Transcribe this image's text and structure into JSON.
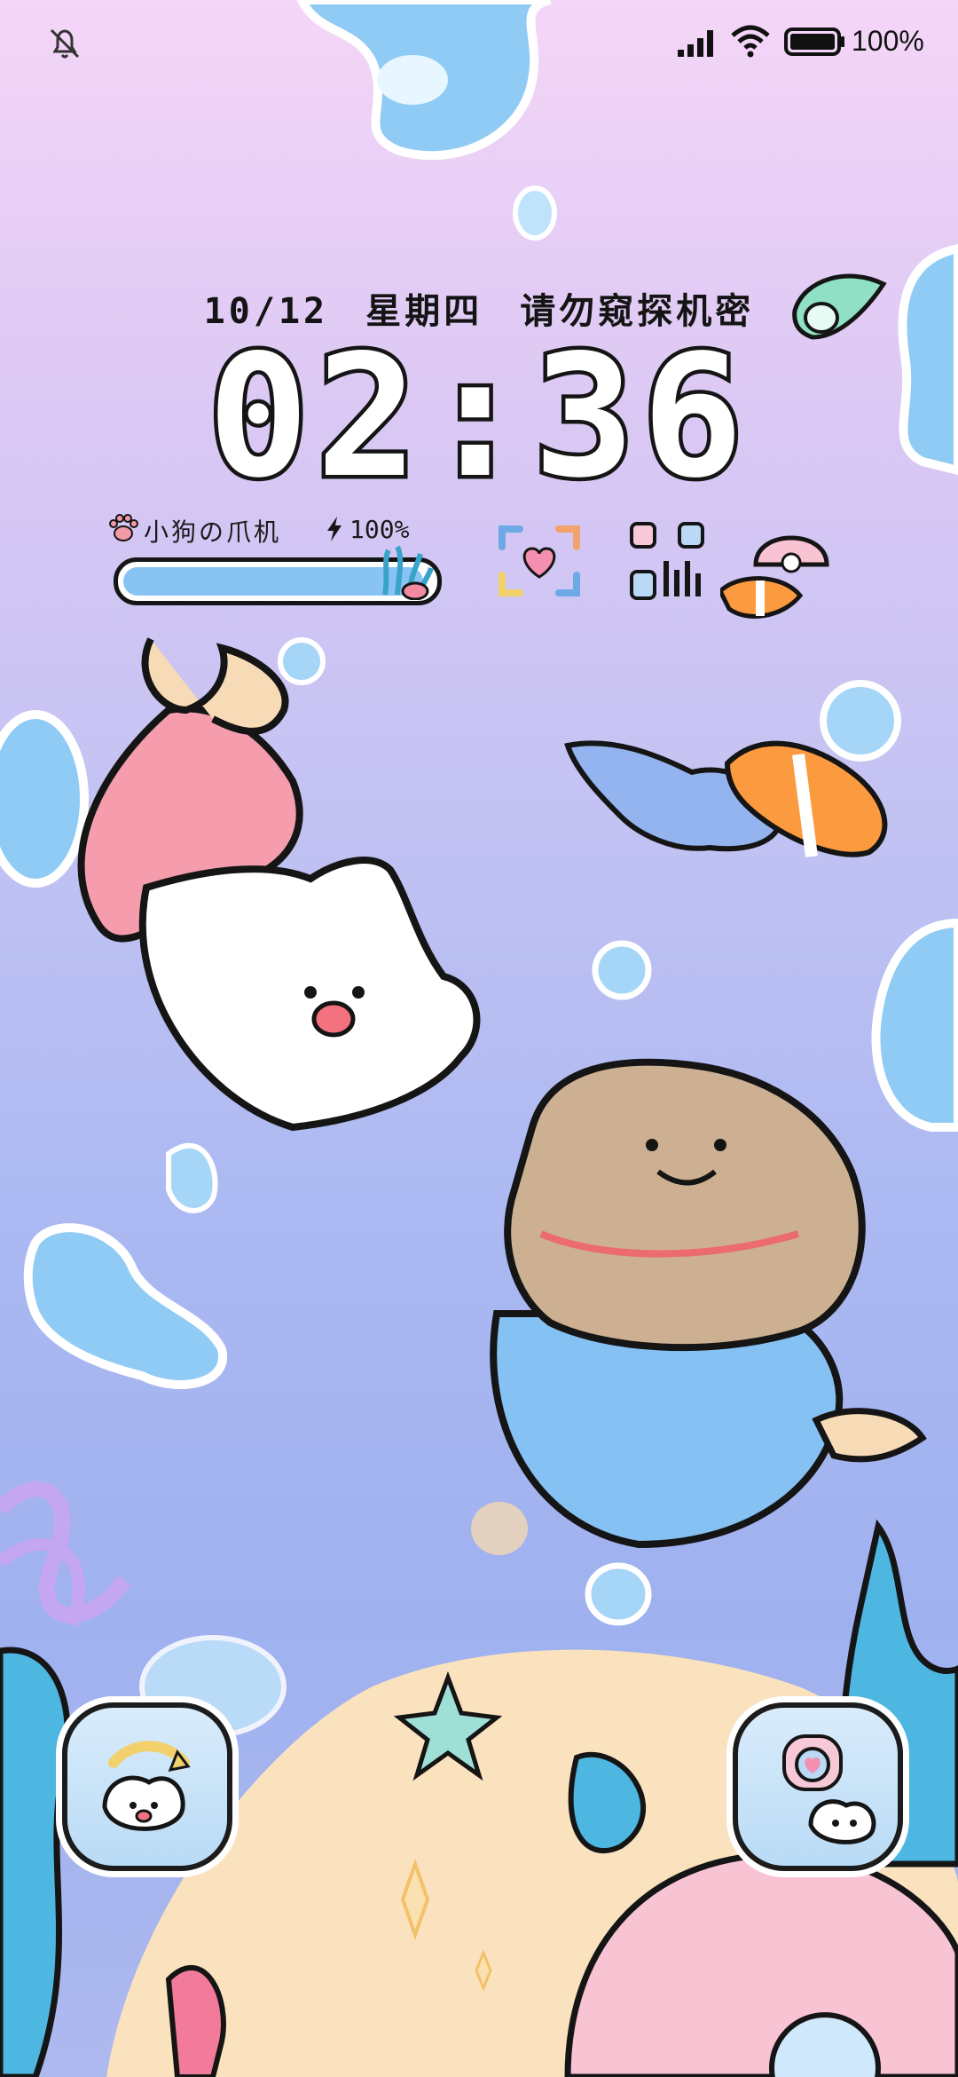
{
  "status_bar": {
    "mute_icon": "bell-off-icon",
    "signal_icon": "cellular-signal-icon",
    "wifi_icon": "wifi-icon",
    "battery_icon": "battery-full-icon",
    "battery_percent": "100%"
  },
  "lockscreen": {
    "date": "10/12  星期四  请勿窥探机密",
    "time": "02:36"
  },
  "battery_widget": {
    "device_name": "小狗の爪机",
    "percent": "100%",
    "level": 1.0,
    "paw_icon": "paw-icon",
    "bolt_icon": "charging-bolt-icon"
  },
  "widgets": {
    "scan_icon": "heart-scan-icon",
    "qr_icon": "qr-code-icon"
  },
  "shortcuts": {
    "left_icon": "rotate-dog-shortcut-icon",
    "right_icon": "heart-dog-shortcut-icon"
  },
  "colors": {
    "bg_top": "#f4d6f7",
    "bg_bottom": "#9fb1ef",
    "bar_fill": "#89c3f3"
  }
}
